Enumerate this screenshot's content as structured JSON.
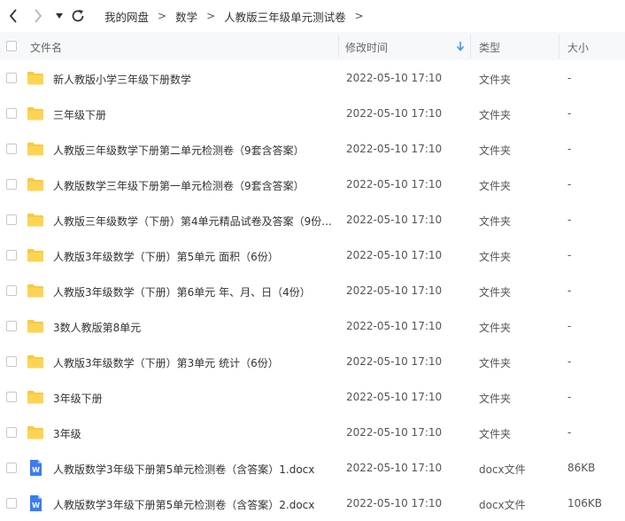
{
  "toolbar": {
    "back_icon": "chevron-left-icon",
    "forward_icon": "chevron-right-icon",
    "dropdown_icon": "caret-down-icon",
    "refresh_icon": "refresh-icon"
  },
  "breadcrumb": {
    "items": [
      "我的网盘",
      "数学",
      "人教版三年级单元测试卷"
    ],
    "separator": ">"
  },
  "columns": {
    "name": "文件名",
    "date": "修改时间",
    "type": "类型",
    "size": "大小"
  },
  "sort": {
    "column": "date",
    "direction": "descending",
    "accent": "#3b95f6"
  },
  "colors": {
    "folder": "#f9c940",
    "doc": "#3a7cf2"
  },
  "files": [
    {
      "icon": "folder",
      "name": "新人教版小学三年级下册数学",
      "date": "2022-05-10 17:10",
      "type": "文件夹",
      "size": "-"
    },
    {
      "icon": "folder",
      "name": "三年级下册",
      "date": "2022-05-10 17:10",
      "type": "文件夹",
      "size": "-"
    },
    {
      "icon": "folder",
      "name": "人教版三年级数学下册第二单元检测卷（9套含答案）",
      "date": "2022-05-10 17:10",
      "type": "文件夹",
      "size": "-"
    },
    {
      "icon": "folder",
      "name": "人教版数学三年级下册第一单元检测卷（9套含答案）",
      "date": "2022-05-10 17:10",
      "type": "文件夹",
      "size": "-"
    },
    {
      "icon": "folder",
      "name": "人教版三年级数学（下册）第4单元精品试卷及答案（9份...",
      "date": "2022-05-10 17:10",
      "type": "文件夹",
      "size": "-"
    },
    {
      "icon": "folder",
      "name": "人教版3年级数学（下册）第5单元 面积（6份）",
      "date": "2022-05-10 17:10",
      "type": "文件夹",
      "size": "-"
    },
    {
      "icon": "folder",
      "name": "人教版3年级数学（下册）第6单元 年、月、日（4份）",
      "date": "2022-05-10 17:10",
      "type": "文件夹",
      "size": "-"
    },
    {
      "icon": "folder",
      "name": "3数人教版第8单元",
      "date": "2022-05-10 17:10",
      "type": "文件夹",
      "size": "-"
    },
    {
      "icon": "folder",
      "name": "人教版3年级数学（下册）第3单元 统计（6份）",
      "date": "2022-05-10 17:10",
      "type": "文件夹",
      "size": "-"
    },
    {
      "icon": "folder",
      "name": "3年级下册",
      "date": "2022-05-10 17:10",
      "type": "文件夹",
      "size": "-"
    },
    {
      "icon": "folder",
      "name": "3年级",
      "date": "2022-05-10 17:10",
      "type": "文件夹",
      "size": "-"
    },
    {
      "icon": "word",
      "name": "人教版数学3年级下册第5单元检测卷（含答案）1.docx",
      "date": "2022-05-10 17:10",
      "type": "docx文件",
      "size": "86KB"
    },
    {
      "icon": "word",
      "name": "人教版数学3年级下册第5单元检测卷（含答案）2.docx",
      "date": "2022-05-10 17:10",
      "type": "docx文件",
      "size": "106KB"
    }
  ]
}
